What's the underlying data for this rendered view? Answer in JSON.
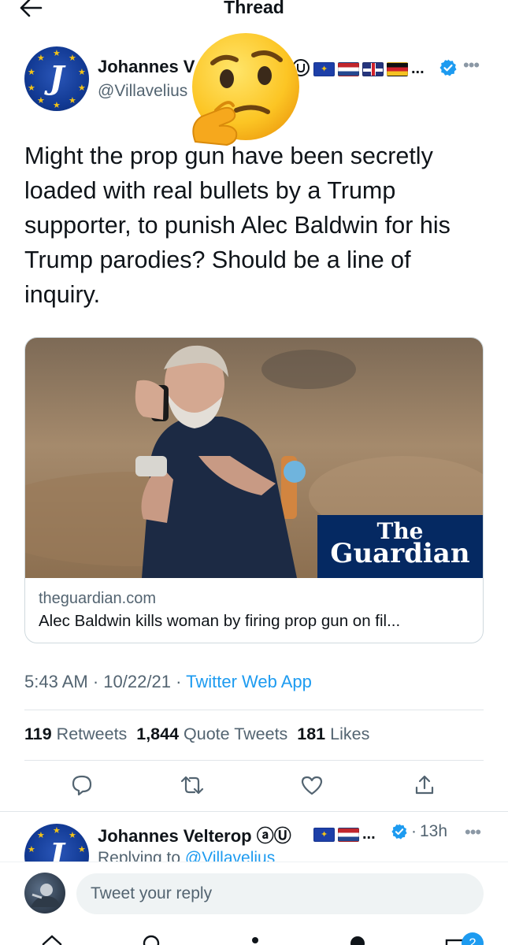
{
  "header": {
    "title": "Thread",
    "back_icon": "arrow-left-icon"
  },
  "tweet": {
    "author_name": "Johannes V",
    "handle": "@Villavelius",
    "name_suffix_icons": [
      "circled-a-icon",
      "circled-u-icon"
    ],
    "flags": [
      "eu-flag",
      "netherlands-flag",
      "uk-flag",
      "germany-flag"
    ],
    "flags_ellipsis": "...",
    "verified_icon": "verified-badge-icon",
    "more_icon": "more-options-icon",
    "overlay_emoji": "thinking-face-emoji",
    "text": "Might the prop gun have been secretly loaded with real bullets by a Trump supporter, to punish Alec Baldwin for his Trump parodies? Should be a line of inquiry.",
    "link_card": {
      "logo_line1": "The",
      "logo_line2": "Guardian",
      "domain": "theguardian.com",
      "title": "Alec Baldwin kills woman by firing prop gun on fil..."
    },
    "time": "5:43 AM",
    "date": "10/22/21",
    "separator": "·",
    "source": "Twitter Web App",
    "stats": {
      "retweets_count": "119",
      "retweets_label": "Retweets",
      "quotes_count": "1,844",
      "quotes_label": "Quote Tweets",
      "likes_count": "181",
      "likes_label": "Likes"
    },
    "actions": [
      "reply-icon",
      "retweet-icon",
      "like-icon",
      "share-icon"
    ]
  },
  "reply": {
    "author_name": "Johannes Velterop ⓐⓊ",
    "flags": [
      "eu-flag",
      "netherlands-flag"
    ],
    "flags_ellipsis": "...",
    "time_ago": "13h",
    "replying_prefix": "Replying to",
    "replying_handle": "@Villavelius"
  },
  "composer": {
    "placeholder": "Tweet your reply"
  },
  "bottom_nav": {
    "items": [
      "home-icon",
      "search-icon",
      "spaces-icon",
      "notifications-icon",
      "messages-icon"
    ],
    "badge": "2"
  },
  "colors": {
    "accent": "#1d9bf0",
    "text": "#0f1419",
    "muted": "#536471",
    "guardian": "#052962"
  }
}
